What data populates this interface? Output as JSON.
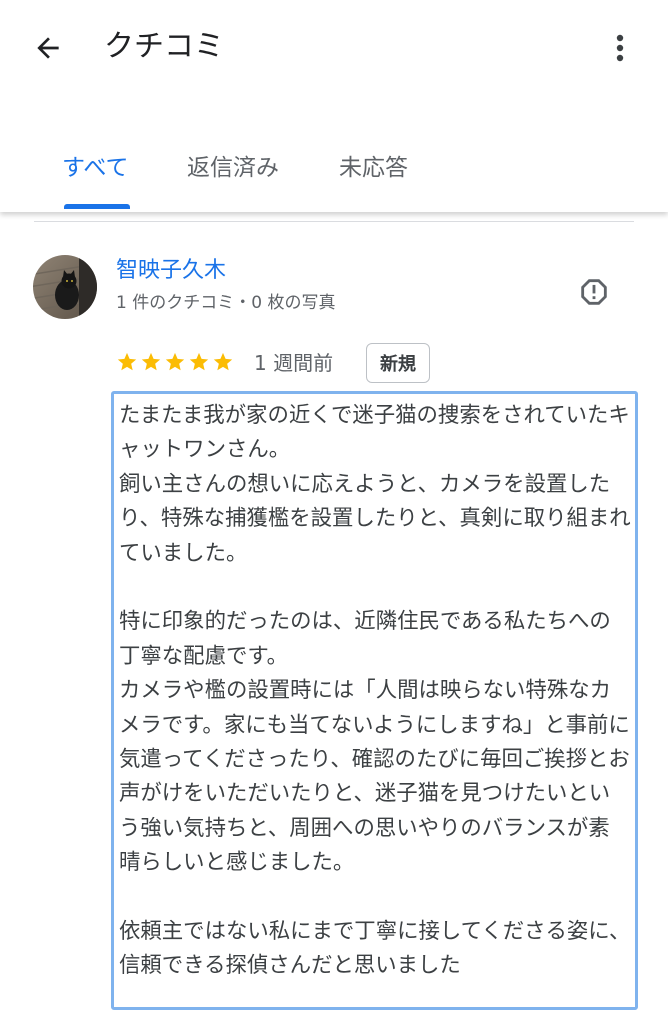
{
  "header": {
    "title": "クチコミ",
    "back_icon": "arrow-back-icon",
    "more_icon": "more-vert-icon"
  },
  "tabs": [
    {
      "label": "すべて",
      "active": true
    },
    {
      "label": "返信済み",
      "active": false
    },
    {
      "label": "未応答",
      "active": false
    }
  ],
  "review": {
    "reviewer_name": "智映子久木",
    "reviewer_meta": "1 件のクチコミ・0 枚の写真",
    "rating": 5,
    "time_ago": "1 週間前",
    "badge": "新規",
    "report_icon": "report-icon",
    "paragraphs": [
      "たまたま我が家の近くで迷子猫の捜索をされていたキャットワンさん。\n飼い主さんの想いに応えようと、カメラを設置したり、特殊な捕獲檻を設置したりと、真剣に取り組まれていました。",
      "特に印象的だったのは、近隣住民である私たちへの丁寧な配慮です。\nカメラや檻の設置時には「人間は映らない特殊なカメラです。家にも当てないようにしますね」と事前に気遣ってくださったり、確認のたびに毎回ご挨拶とお声がけをいただいたりと、迷子猫を見つけたいという強い気持ちと、周囲への思いやりのバランスが素晴らしいと感じました。",
      "依頼主ではない私にまで丁寧に接してくださる姿に、信頼できる探偵さんだと思いました"
    ]
  },
  "colors": {
    "accent": "#1a73e8",
    "star": "#fbbc04",
    "selection_border": "#7fb3ee"
  }
}
